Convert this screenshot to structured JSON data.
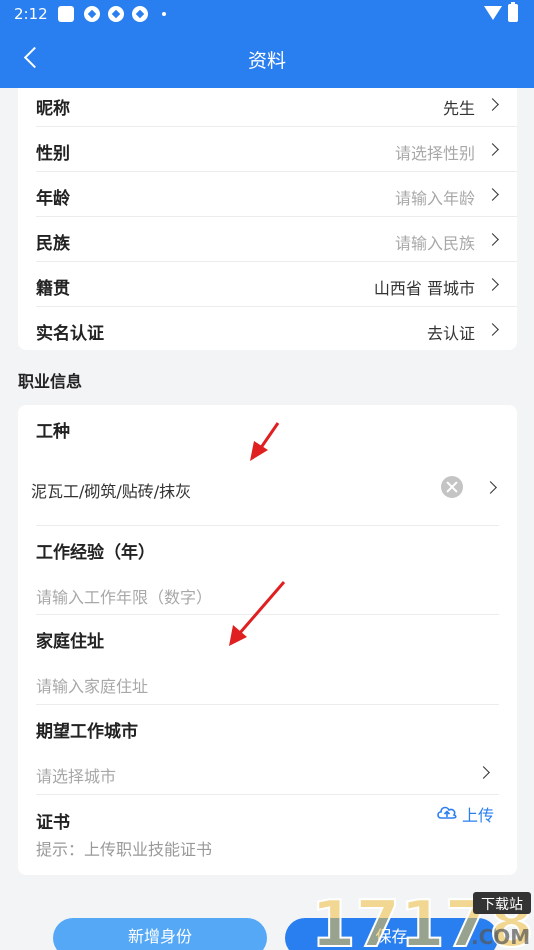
{
  "status_bar": {
    "time": "2:12"
  },
  "nav": {
    "title": "资料"
  },
  "basic_rows": [
    {
      "label": "昵称",
      "value": "先生",
      "placeholder": false
    },
    {
      "label": "性别",
      "value": "请选择性别",
      "placeholder": true
    },
    {
      "label": "年龄",
      "value": "请输入年龄",
      "placeholder": true
    },
    {
      "label": "民族",
      "value": "请输入民族",
      "placeholder": true
    },
    {
      "label": "籍贯",
      "value": "山西省 晋城市",
      "placeholder": false
    },
    {
      "label": "实名认证",
      "value": "去认证",
      "placeholder": false
    }
  ],
  "section_title": "职业信息",
  "job": {
    "label": "工种",
    "value": "泥瓦工/砌筑/贴砖/抹灰",
    "experience_label": "工作经验（年）",
    "experience_placeholder": "请输入工作年限（数字）",
    "address_label": "家庭住址",
    "address_placeholder": "请输入家庭住址",
    "city_label": "期望工作城市",
    "city_placeholder": "请选择城市",
    "cert_label": "证书",
    "cert_hint": "提示：上传职业技能证书",
    "upload_label": "上传"
  },
  "buttons": {
    "add_identity": "新增身份",
    "save": "保存"
  },
  "watermark": {
    "number": "17178",
    "tag": "下载站",
    "domain": ".COM"
  },
  "colors": {
    "primary": "#2a7ff0",
    "secondary_button": "#55a8f6",
    "annotation_arrow": "#e02020"
  }
}
